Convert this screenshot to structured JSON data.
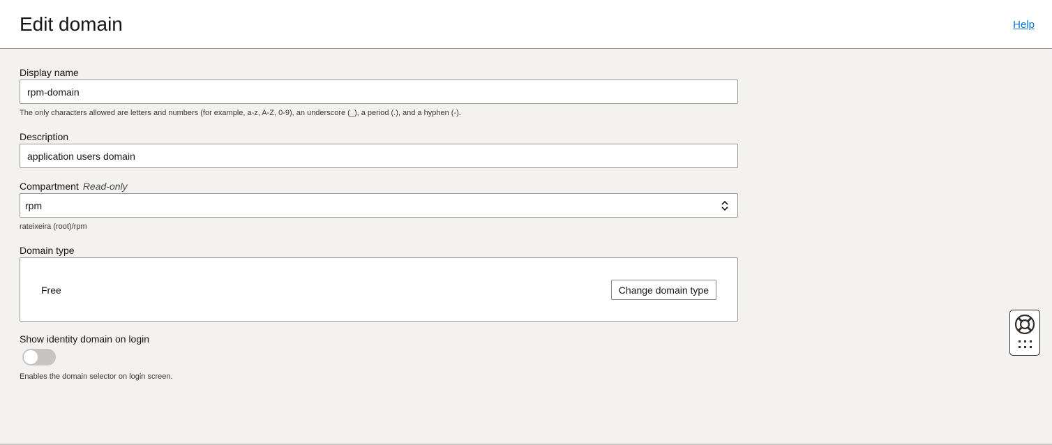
{
  "header": {
    "title": "Edit domain",
    "help_label": "Help"
  },
  "form": {
    "display_name": {
      "label": "Display name",
      "value": "rpm-domain",
      "helper": "The only characters allowed are letters and numbers (for example, a-z, A-Z, 0-9), an underscore (_), a period (.), and a hyphen (-)."
    },
    "description": {
      "label": "Description",
      "value": "application users domain"
    },
    "compartment": {
      "label": "Compartment",
      "readonly_tag": "Read-only",
      "selected": "rpm",
      "path": "rateixeira (root)/rpm"
    },
    "domain_type": {
      "label": "Domain type",
      "value": "Free",
      "change_button": "Change domain type"
    },
    "show_identity": {
      "label": "Show identity domain on login",
      "enabled": false,
      "helper": "Enables the domain selector on login screen."
    }
  },
  "colors": {
    "accent_link": "#0572ce",
    "background": "#f3f2f1"
  },
  "icons": {
    "compartment_select": "chevron-up-down-icon",
    "help_widget": "lifebuoy-icon",
    "apps_widget": "grid-dots-icon"
  }
}
